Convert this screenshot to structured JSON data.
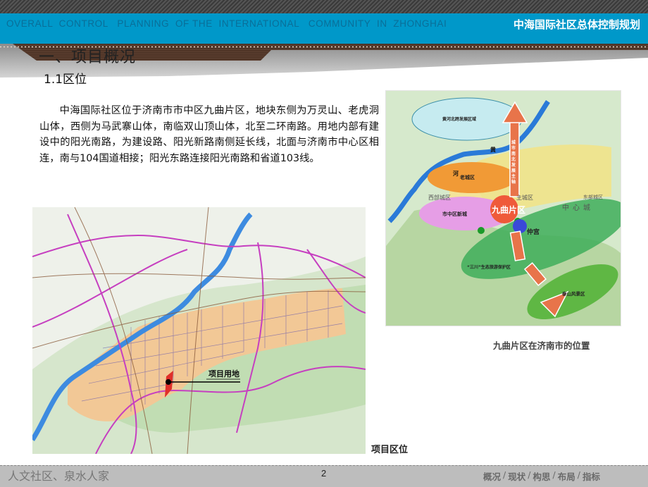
{
  "header": {
    "english_title": "OVERALL  CONTROL   PLANNING  OF THE  INTERNATIONAL   COMMUNITY  IN  ZHONGHAI",
    "chinese_title": "中海国际社区总体控制规划",
    "band_color": "#0098c9"
  },
  "section": {
    "title": "一、项目概况",
    "subtitle": "1.1区位"
  },
  "body": {
    "paragraph": "中海国际社区位于济南市市中区九曲片区，地块东侧为万灵山、老虎洞山体，西侧为马武寨山体，南临双山顶山体，北至二环南路。用地内部有建设中的阳光南路，为建设路、阳光新路南侧延长线，北面与济南市中心区相连，南与104国道相接；阳光东路连接阳光南路和省道103线。"
  },
  "main_map": {
    "site_label": "项目用地",
    "caption": "项目区位"
  },
  "side_map": {
    "caption": "九曲片区在济南市的位置",
    "labels": {
      "north_zone": "黄河北跨发展区域",
      "axis": "城市南北发展主轴",
      "old_city": "老城区",
      "jiuqu": "九曲片区",
      "new_city": "市中区新城",
      "west_city": "西部城区",
      "main_city": "主城区",
      "east_city": "东部城区",
      "center": "中心城",
      "zhonggong": "仲宫",
      "sanchuan": "“三川”生态旅游保护区",
      "taishan": "泰山风景区",
      "river_huang": "黄",
      "river_he": "河"
    }
  },
  "footer": {
    "slogan": "人文社区、泉水人家",
    "page_number": "2",
    "nav": [
      "概况",
      "现状",
      "构思",
      "布局",
      "指标"
    ],
    "separator": "/"
  }
}
